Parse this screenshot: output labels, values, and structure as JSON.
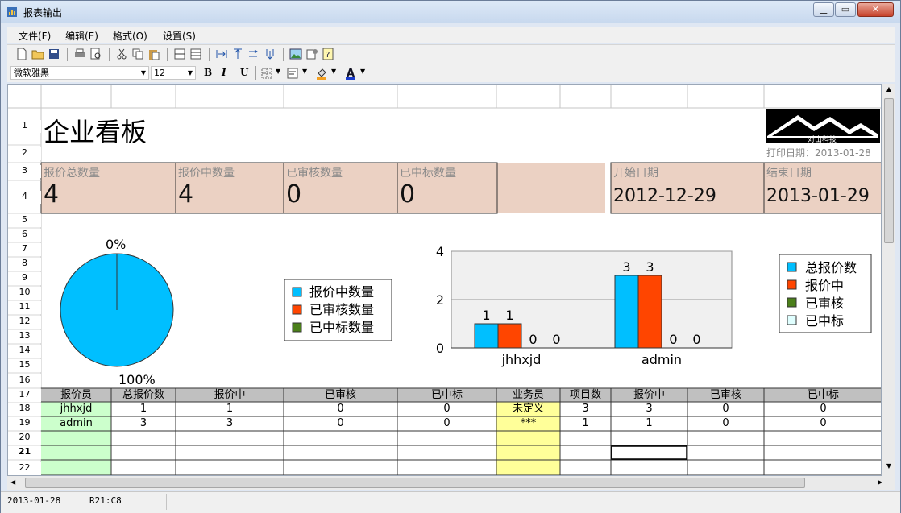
{
  "window": {
    "title": "报表输出"
  },
  "menu": [
    "文件(F)",
    "编辑(E)",
    "格式(O)",
    "设置(S)"
  ],
  "format": {
    "font_name": "微软雅黑",
    "font_size": "12",
    "bold": "B",
    "italic": "I",
    "underline": "U"
  },
  "window_buttons": {
    "minimize": "▁",
    "maximize": "▭",
    "close": "✕"
  },
  "rows": [
    "1",
    "2",
    "3",
    "4",
    "5",
    "6",
    "7",
    "8",
    "9",
    "10",
    "11",
    "12",
    "13",
    "14",
    "15",
    "16",
    "17",
    "18",
    "19",
    "20",
    "21",
    "22"
  ],
  "report": {
    "title": "企业看板",
    "logo_text": "对山科技",
    "print_date": "打印日期：2013-01-28",
    "kpis": [
      {
        "label": "报价总数量",
        "value": "4"
      },
      {
        "label": "报价中数量",
        "value": "4"
      },
      {
        "label": "已审核数量",
        "value": "0"
      },
      {
        "label": "已中标数量",
        "value": "0"
      }
    ],
    "start_label": "开始日期",
    "start_value": "2012-12-29",
    "end_label": "结束日期",
    "end_value": "2013-01-29"
  },
  "pie": {
    "type": "pie",
    "slices": [
      {
        "name": "报价中数量",
        "value": 100,
        "label": "100%",
        "color": "#00bfff"
      },
      {
        "name": "已审核数量",
        "value": 0,
        "label": "0%",
        "color": "#ff4500"
      },
      {
        "name": "已中标数量",
        "value": 0,
        "label": "",
        "color": "#4b7f1a"
      }
    ]
  },
  "chart_data": {
    "type": "bar",
    "categories": [
      "jhhxjd",
      "admin"
    ],
    "series": [
      {
        "name": "总报价数",
        "values": [
          1,
          3
        ],
        "color": "#00bfff"
      },
      {
        "name": "报价中",
        "values": [
          1,
          3
        ],
        "color": "#ff4500"
      },
      {
        "name": "已审核",
        "values": [
          0,
          0
        ],
        "color": "#4b7f1a"
      },
      {
        "name": "已中标",
        "values": [
          0,
          0
        ],
        "color": "#e0ffff"
      }
    ],
    "ylim": [
      0,
      4
    ],
    "yticks": [
      "0",
      "2",
      "4"
    ],
    "grid": true,
    "legend": "right"
  },
  "table": {
    "headers": [
      "报价员",
      "总报价数",
      "报价中",
      "已审核",
      "已中标",
      "业务员",
      "项目数",
      "报价中",
      "已审核",
      "已中标"
    ],
    "rows": [
      [
        "jhhxjd",
        "1",
        "1",
        "0",
        "0",
        "未定义",
        "3",
        "3",
        "0",
        "0"
      ],
      [
        "admin",
        "3",
        "3",
        "0",
        "0",
        "***",
        "1",
        "1",
        "0",
        "0"
      ]
    ]
  },
  "status": {
    "date": "2013-01-28",
    "cell": "R21:C8"
  },
  "colors": {
    "kpi_bg": "#ebd1c3",
    "header_bg": "#c0c0c0",
    "green_col": "#ccffcc",
    "yellow_col": "#ffff99"
  }
}
